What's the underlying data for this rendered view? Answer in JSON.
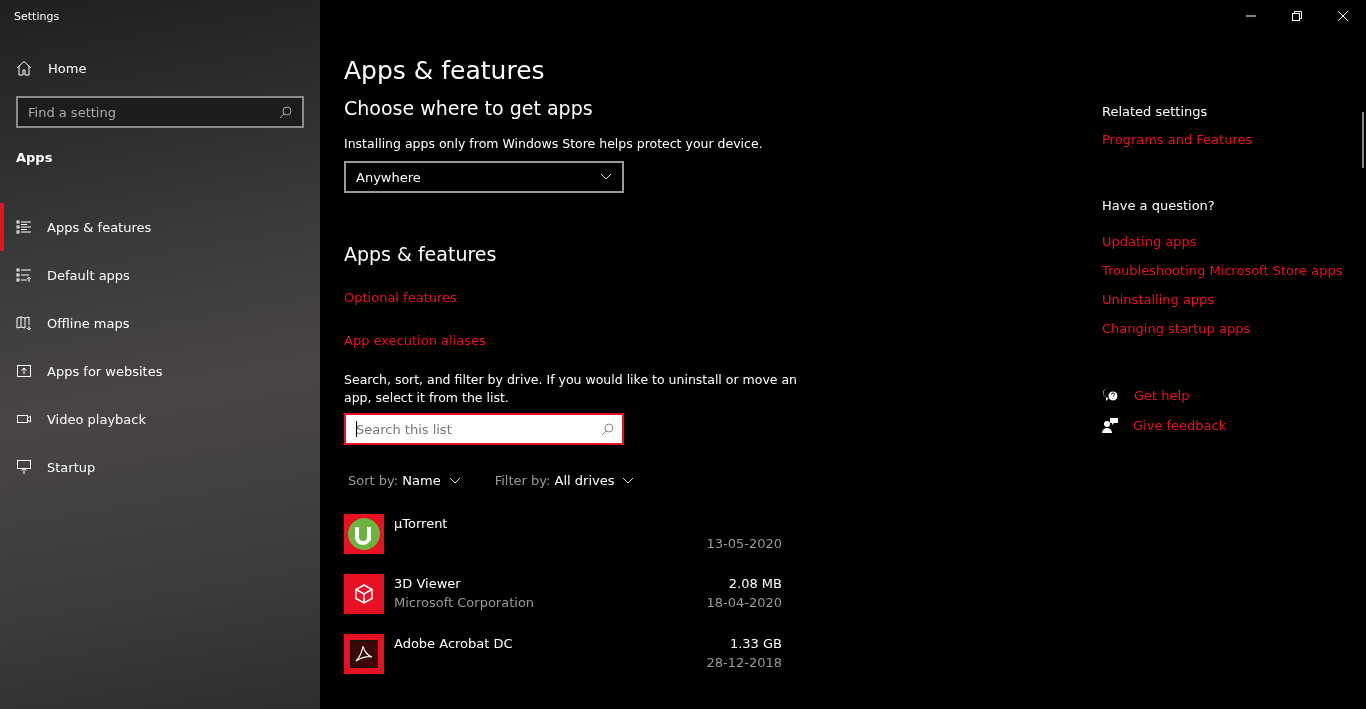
{
  "window": {
    "title": "Settings"
  },
  "sidebar": {
    "home": "Home",
    "search": {
      "placeholder": "Find a setting"
    },
    "section": "Apps",
    "items": [
      {
        "label": "Apps & features",
        "kind": "list",
        "selected": true
      },
      {
        "label": "Default apps",
        "kind": "default",
        "selected": false
      },
      {
        "label": "Offline maps",
        "kind": "map",
        "selected": false
      },
      {
        "label": "Apps for websites",
        "kind": "web",
        "selected": false
      },
      {
        "label": "Video playback",
        "kind": "video",
        "selected": false
      },
      {
        "label": "Startup",
        "kind": "startup",
        "selected": false
      }
    ]
  },
  "main": {
    "title": "Apps & features",
    "choose_heading": "Choose where to get apps",
    "choose_text": "Installing apps only from Windows Store helps protect your device.",
    "dropdown": "Anywhere",
    "section_heading": "Apps & features",
    "links": [
      "Optional features",
      "App execution aliases"
    ],
    "description": "Search, sort, and filter by drive. If you would like to uninstall or move an app, select it from the list.",
    "list_search": {
      "placeholder": "Search this list"
    },
    "sort": {
      "label": "Sort by:",
      "value": "Name"
    },
    "filter": {
      "label": "Filter by:",
      "value": "All drives"
    },
    "apps": [
      {
        "name": "µTorrent",
        "kind": "torrent",
        "date": "13-05-2020"
      },
      {
        "name": "3D Viewer",
        "kind": "cube",
        "publisher": "Microsoft Corporation",
        "size": "2.08 MB",
        "date": "18-04-2020"
      },
      {
        "name": "Adobe Acrobat DC",
        "kind": "acrobat",
        "size": "1.33 GB",
        "date": "28-12-2018"
      }
    ]
  },
  "aside": {
    "related_heading": "Related settings",
    "related_links": [
      "Programs and Features"
    ],
    "question_heading": "Have a question?",
    "question_links": [
      "Updating apps",
      "Troubleshooting Microsoft Store apps",
      "Uninstalling apps",
      "Changing startup apps"
    ],
    "actions": [
      {
        "label": "Get help",
        "kind": "help"
      },
      {
        "label": "Give feedback",
        "kind": "feedback"
      }
    ]
  }
}
